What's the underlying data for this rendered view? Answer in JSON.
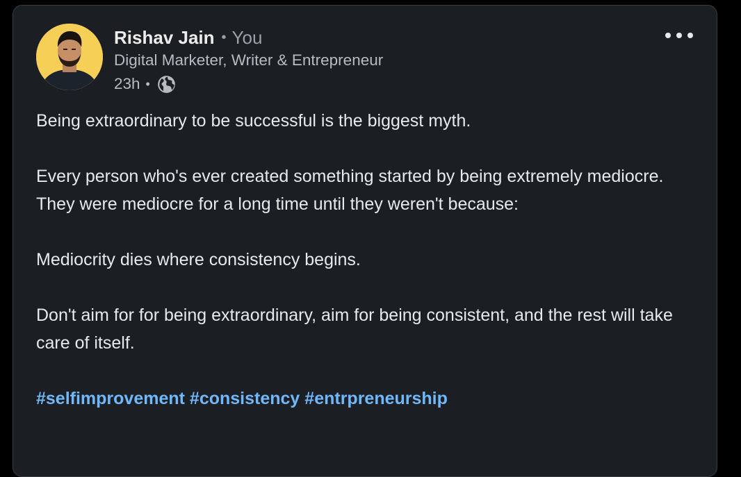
{
  "post": {
    "author": {
      "name": "Rishav Jain",
      "relation": "You",
      "headline": "Digital Marketer, Writer & Entrepreneur",
      "timestamp": "23h",
      "visibility_icon": "globe-icon"
    },
    "menu_icon": "more-horizontal-icon",
    "body": {
      "paragraph_1": "Being extraordinary to be successful is the biggest myth.",
      "paragraph_2": "Every person who's ever created something started by being extremely mediocre. They were mediocre for a long time until they weren't because:",
      "paragraph_3": "Mediocrity dies where consistency begins.",
      "paragraph_4": "Don't aim for for being extraordinary, aim for being consistent, and the rest will take care of itself."
    },
    "hashtags": [
      "#selfimprovement",
      "#consistency",
      "#entrpreneurship"
    ]
  },
  "colors": {
    "background": "#000000",
    "card": "#1b1f23",
    "text": "#e8e9ea",
    "muted": "#b8bcc1",
    "link": "#71b7fb",
    "avatar_bg": "#f6cf57"
  }
}
